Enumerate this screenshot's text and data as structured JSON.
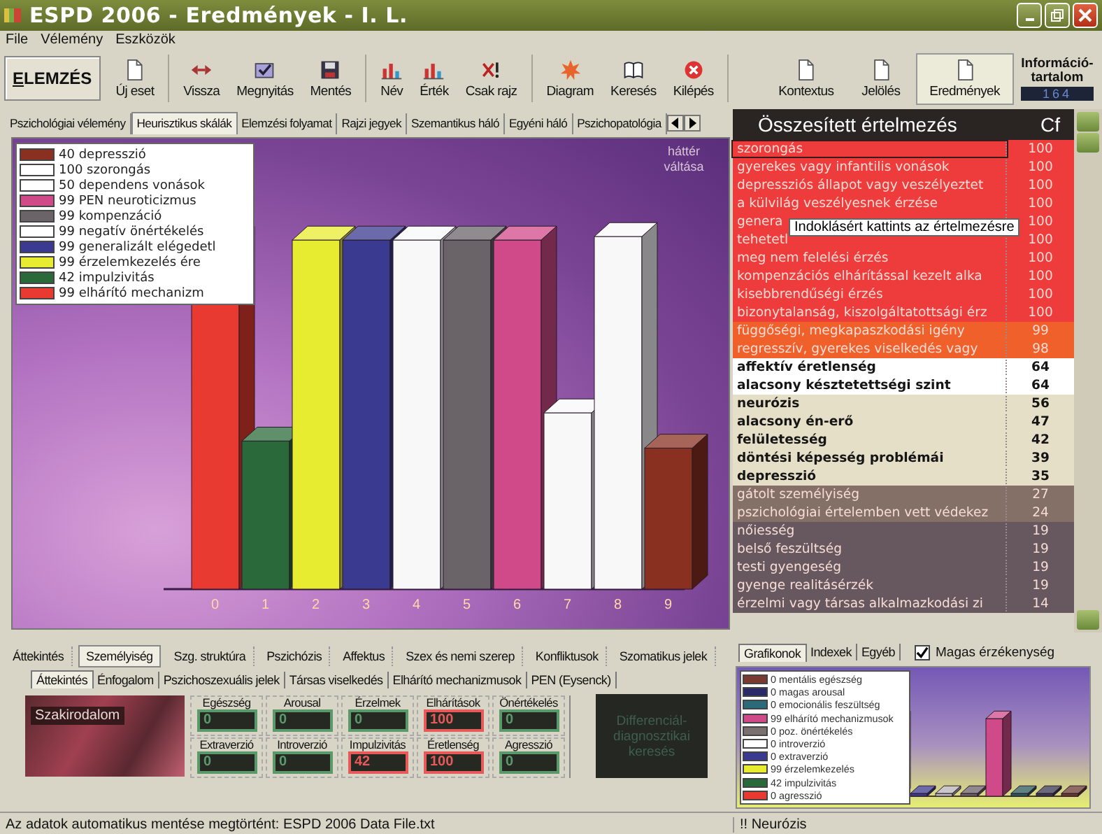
{
  "window": {
    "title": "ESPD 2006 - Eredmények - I. L."
  },
  "menu": [
    "File",
    "Vélemény",
    "Eszközök"
  ],
  "toolbar": {
    "main_button": "ELEMZÉS",
    "buttons": [
      {
        "label": "Új eset"
      },
      {
        "label": "Vissza"
      },
      {
        "label": "Megnyitás"
      },
      {
        "label": "Mentés"
      },
      {
        "label": "Név"
      },
      {
        "label": "Érték"
      },
      {
        "label": "Csak rajz"
      },
      {
        "label": "Diagram"
      },
      {
        "label": "Keresés"
      },
      {
        "label": "Kilépés"
      }
    ],
    "right_buttons": [
      {
        "label": "Kontextus",
        "selected": false
      },
      {
        "label": "Jelölés",
        "selected": false
      },
      {
        "label": "Eredmények",
        "selected": true
      }
    ],
    "info": {
      "label": "Információ-tartalom",
      "value": "164"
    }
  },
  "main_tabs": [
    {
      "label": "Pszichológiai vélemény",
      "selected": false
    },
    {
      "label": "Heurisztikus skálák",
      "selected": true
    },
    {
      "label": "Elemzési folyamat",
      "selected": false
    },
    {
      "label": "Rajzi jegyek",
      "selected": false
    },
    {
      "label": "Szemantikus háló",
      "selected": false
    },
    {
      "label": "Egyéni háló",
      "selected": false
    },
    {
      "label": "Pszichopatológia",
      "selected": false
    }
  ],
  "chart": {
    "background_label": "háttér váltása",
    "legend": [
      {
        "label": "40  depresszió",
        "color": "#8a3020"
      },
      {
        "label": "100 szorongás",
        "color": "#ffffff"
      },
      {
        "label": "50 dependens vonások",
        "color": "#ffffff"
      },
      {
        "label": "99 PEN neuroticizmus",
        "color": "#d04a8a"
      },
      {
        "label": "99 kompenzáció",
        "color": "#6a6468"
      },
      {
        "label": "99 negatív önértékelés",
        "color": "#ffffff"
      },
      {
        "label": "99 generalizált elégedetl",
        "color": "#3a3a90"
      },
      {
        "label": "99 érzelemkezelés ére",
        "color": "#e8ec30"
      },
      {
        "label": "42 impulzivitás",
        "color": "#2a6a3a"
      },
      {
        "label": "99 elhárító mechanizm",
        "color": "#e83a30"
      }
    ],
    "x_labels": [
      "0",
      "1",
      "2",
      "3",
      "4",
      "5",
      "6",
      "7",
      "8",
      "9"
    ]
  },
  "summary": {
    "title": "Összesített értelmezés",
    "cf_label": "Cf",
    "tooltip": "Indoklásért kattints az értelmezésre",
    "rows": [
      {
        "text": "szorongás",
        "cf": "100",
        "color": "#ee3b3b",
        "selected": true
      },
      {
        "text": "gyerekes vagy infantilis vonások",
        "cf": "100",
        "color": "#ee3b3b",
        "selected": false
      },
      {
        "text": "depressziós állapot vagy veszélyeztet",
        "cf": "100",
        "color": "#ee3b3b",
        "selected": false
      },
      {
        "text": "a külvilág veszélyesnek érzése",
        "cf": "100",
        "color": "#ee3b3b",
        "selected": false
      },
      {
        "text": "genera",
        "cf": "100",
        "color": "#ee3b3b",
        "selected": false
      },
      {
        "text": "tehetetl",
        "cf": "100",
        "color": "#ee3b3b",
        "selected": false
      },
      {
        "text": "meg nem felelési érzés",
        "cf": "100",
        "color": "#ee3b3b",
        "selected": false
      },
      {
        "text": "kompenzációs elhárítással kezelt alka",
        "cf": "100",
        "color": "#ee3b3b",
        "selected": false
      },
      {
        "text": "kisebbrendűségi érzés",
        "cf": "100",
        "color": "#ee3b3b",
        "selected": false
      },
      {
        "text": "bizonytalanság, kiszolgáltatottsági érz",
        "cf": "100",
        "color": "#ee3b3b",
        "selected": false
      },
      {
        "text": "függőségi, megkapaszkodási igény",
        "cf": "99",
        "color": "#f0602a",
        "selected": false
      },
      {
        "text": "regresszív, gyerekes viselkedés vagy",
        "cf": "98",
        "color": "#f0602a",
        "selected": false
      },
      {
        "text": "affektív éretlenség",
        "cf": "64",
        "color": "#ffffff",
        "selected": false
      },
      {
        "text": "alacsony késztetettségi szint",
        "cf": "64",
        "color": "#ffffff",
        "selected": false
      },
      {
        "text": "neurózis",
        "cf": "56",
        "color": "#e6dfc8",
        "selected": false
      },
      {
        "text": "alacsony én-erő",
        "cf": "47",
        "color": "#e6dfc8",
        "selected": false
      },
      {
        "text": "felületesség",
        "cf": "42",
        "color": "#e6dfc8",
        "selected": false
      },
      {
        "text": "döntési képesség problémái",
        "cf": "39",
        "color": "#e6dfc8",
        "selected": false
      },
      {
        "text": "depresszió",
        "cf": "35",
        "color": "#e6dfc8",
        "selected": false
      },
      {
        "text": "gátolt személyiség",
        "cf": "27",
        "color": "#857068",
        "selected": false
      },
      {
        "text": "pszichológiai értelemben vett védekez",
        "cf": "24",
        "color": "#857068",
        "selected": false
      },
      {
        "text": "nőiesség",
        "cf": "19",
        "color": "#675860",
        "selected": false
      },
      {
        "text": "belső feszültség",
        "cf": "19",
        "color": "#675860",
        "selected": false
      },
      {
        "text": "testi gyengeség",
        "cf": "19",
        "color": "#675860",
        "selected": false
      },
      {
        "text": "gyenge realitásérzék",
        "cf": "19",
        "color": "#675860",
        "selected": false
      },
      {
        "text": "érzelmi vagy társas alkalmazkodási zi",
        "cf": "14",
        "color": "#675860",
        "selected": false
      }
    ]
  },
  "bottom": {
    "tabs": [
      {
        "label": "Áttekintés",
        "selected": false
      },
      {
        "label": "Személyiség",
        "selected": true
      },
      {
        "label": "Szg. struktúra",
        "selected": false
      },
      {
        "label": "Pszichózis",
        "selected": false
      },
      {
        "label": "Affektus",
        "selected": false
      },
      {
        "label": "Szex és nemi szerep",
        "selected": false
      },
      {
        "label": "Konfliktusok",
        "selected": false
      },
      {
        "label": "Szomatikus jelek",
        "selected": false
      }
    ],
    "subtabs": [
      {
        "label": "Áttekintés",
        "selected": true
      },
      {
        "label": "Énfogalom",
        "selected": false
      },
      {
        "label": "Pszichoszexuális jelek",
        "selected": false
      },
      {
        "label": "Társas viselkedés",
        "selected": false
      },
      {
        "label": "Elhárító mechanizmusok",
        "selected": false
      },
      {
        "label": "PEN (Eysenck)",
        "selected": false
      }
    ],
    "literature_label": "Szakirodalom",
    "gauges": [
      {
        "label": "Egészség",
        "value": "0",
        "color": "#5a9a6a"
      },
      {
        "label": "Arousal",
        "value": "0",
        "color": "#5a9a6a"
      },
      {
        "label": "Érzelmek",
        "value": "0",
        "color": "#5a9a6a"
      },
      {
        "label": "Elhárítások",
        "value": "100",
        "color": "#e85a5a"
      },
      {
        "label": "Önértékelés",
        "value": "0",
        "color": "#5a9a6a"
      },
      {
        "label": "Extraverzió",
        "value": "0",
        "color": "#5a9a6a"
      },
      {
        "label": "Introverzió",
        "value": "0",
        "color": "#5a9a6a"
      },
      {
        "label": "Impulzivitás",
        "value": "42",
        "color": "#e85a5a"
      },
      {
        "label": "Éretlenség",
        "value": "100",
        "color": "#e85a5a"
      },
      {
        "label": "Agresszió",
        "value": "0",
        "color": "#5a9a6a"
      }
    ],
    "diff_button": "Differenciál-diagnosztikai keresés"
  },
  "side": {
    "tabs": [
      {
        "label": "Grafikonok",
        "selected": true
      },
      {
        "label": "Indexek",
        "selected": false
      },
      {
        "label": "Egyéb",
        "selected": false
      }
    ],
    "checkbox": {
      "label": "Magas érzékenység",
      "checked": true
    },
    "legend": [
      {
        "label": "0 mentális egészség",
        "color": "#7a3a30"
      },
      {
        "label": "0 magas arousal",
        "color": "#2a2a6a"
      },
      {
        "label": "0 emocionális feszültség",
        "color": "#2a6a7a"
      },
      {
        "label": "99 elhárító mechanizmusok",
        "color": "#d04a8a"
      },
      {
        "label": "0 poz. önértékelés",
        "color": "#7a7070"
      },
      {
        "label": "0 introverzió",
        "color": "#ffffff"
      },
      {
        "label": "0 extraverzió",
        "color": "#3a3a90"
      },
      {
        "label": "99 érzelemkezelés",
        "color": "#e8ec30"
      },
      {
        "label": "42 impulzivitás",
        "color": "#2a6a3a"
      },
      {
        "label": "0 agresszió",
        "color": "#e83a30"
      }
    ]
  },
  "status_bar": {
    "message": "Az adatok automatikus mentése megtörtént: ESPD 2006 Data File.txt",
    "right": "!! Neurózis"
  }
}
